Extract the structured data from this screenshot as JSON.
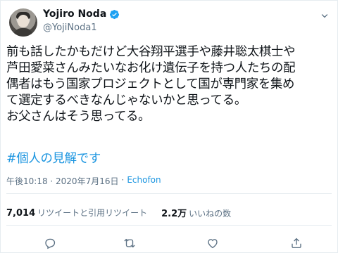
{
  "user": {
    "display_name": "Yojiro Noda",
    "handle": "@YojiNoda1",
    "verified": true
  },
  "tweet": {
    "text": "前も話したかもだけど大谷翔平選手や藤井聡太棋士や\n芦田愛菜さんみたいなお化け遺伝子を持つ人たちの配\n偶者はもう国家プロジェクトとして国が専門家を集め\nて選定するべきなんじゃないかと思ってる。\nお父さんはそう思ってる。",
    "hashtag": "#個人の見解です",
    "timestamp": "午後10:18 · 2020年7月16日",
    "separator": " · ",
    "source": "Echofon"
  },
  "stats": {
    "retweets_count": "7,014",
    "retweets_label": "リツイートと引用リツイート",
    "likes_count": "2.2万",
    "likes_label": "いいねの数"
  },
  "icons": {
    "verified": "verified-badge-icon",
    "caret": "chevron-down-icon",
    "reply": "reply-icon",
    "retweet": "retweet-icon",
    "like": "heart-icon",
    "share": "share-icon"
  },
  "colors": {
    "accent": "#1b95e0",
    "muted": "#5b7083",
    "text": "#0f1419",
    "border": "#e6ecf0"
  }
}
